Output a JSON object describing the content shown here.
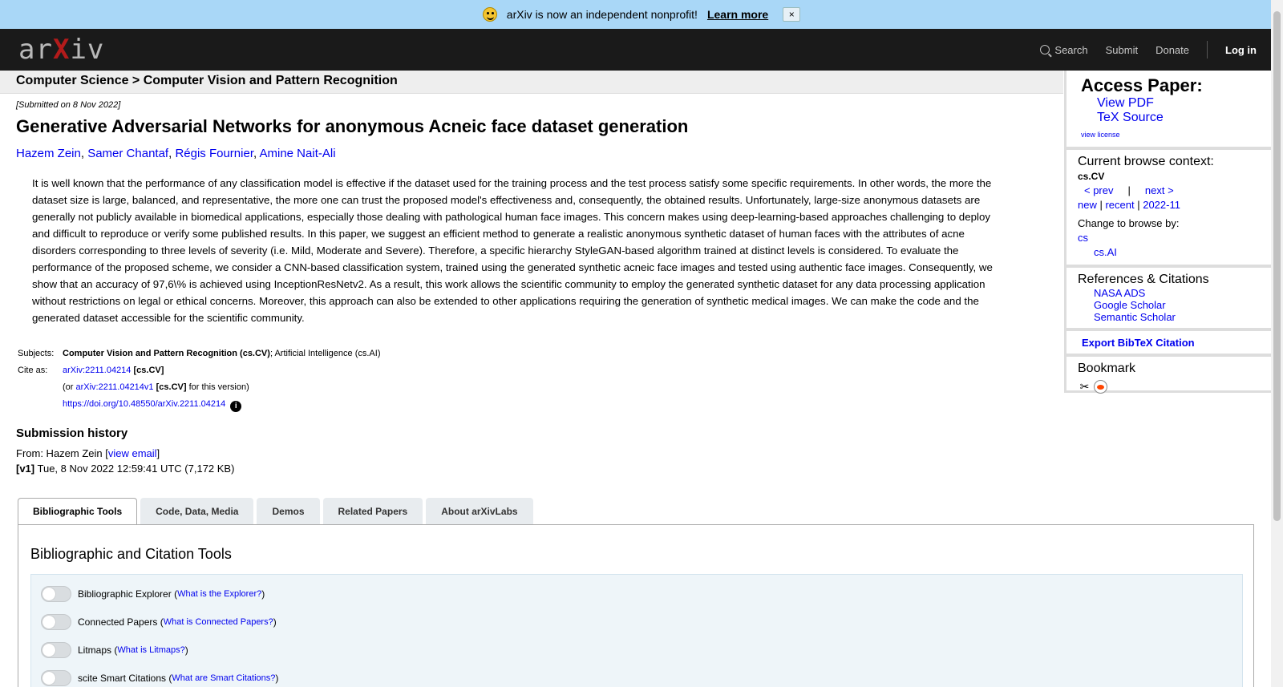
{
  "banner": {
    "text": "arXiv is now an independent nonprofit!",
    "link": "Learn more",
    "close": "×"
  },
  "header": {
    "logo_left": "ar",
    "logo_x": "X",
    "logo_right": "iv",
    "nav": {
      "search": "Search",
      "submit": "Submit",
      "donate": "Donate",
      "login": "Log in"
    }
  },
  "breadcrumb": "Computer Science > Computer Vision and Pattern Recognition",
  "dateline": "[Submitted on 8 Nov 2022]",
  "title": "Generative Adversarial Networks for anonymous Acneic face dataset generation",
  "authors": [
    "Hazem Zein",
    "Samer Chantaf",
    "Régis Fournier",
    "Amine Nait-Ali"
  ],
  "abstract": "It is well known that the performance of any classification model is effective if the dataset used for the training process and the test process satisfy some specific requirements. In other words, the more the dataset size is large, balanced, and representative, the more one can trust the proposed model's effectiveness and, consequently, the obtained results. Unfortunately, large-size anonymous datasets are generally not publicly available in biomedical applications, especially those dealing with pathological human face images. This concern makes using deep-learning-based approaches challenging to deploy and difficult to reproduce or verify some published results. In this paper, we suggest an efficient method to generate a realistic anonymous synthetic dataset of human faces with the attributes of acne disorders corresponding to three levels of severity (i.e. Mild, Moderate and Severe). Therefore, a specific hierarchy StyleGAN-based algorithm trained at distinct levels is considered. To evaluate the performance of the proposed scheme, we consider a CNN-based classification system, trained using the generated synthetic acneic face images and tested using authentic face images. Consequently, we show that an accuracy of 97,6\\% is achieved using InceptionResNetv2. As a result, this work allows the scientific community to employ the generated synthetic dataset for any data processing application without restrictions on legal or ethical concerns. Moreover, this approach can also be extended to other applications requiring the generation of synthetic medical images. We can make the code and the generated dataset accessible for the scientific community.",
  "meta": {
    "subjects_label": "Subjects:",
    "subjects_primary": "Computer Vision and Pattern Recognition (cs.CV)",
    "subjects_rest": "; Artificial Intelligence (cs.AI)",
    "cite_label": "Cite as:",
    "cite_id": "arXiv:2211.04214",
    "cite_cat": "[cs.CV]",
    "or_prefix": "(or ",
    "cite_version": "arXiv:2211.04214v1",
    "cite_version_cat": "[cs.CV]",
    "or_suffix": " for this version)",
    "doi": "https://doi.org/10.48550/arXiv.2211.04214",
    "info": "i"
  },
  "history": {
    "heading": "Submission history",
    "from_prefix": "From: Hazem Zein [",
    "view_email": "view email",
    "from_suffix": "]",
    "v1_label": "[v1]",
    "v1_text": " Tue, 8 Nov 2022 12:59:41 UTC (7,172 KB)"
  },
  "tabs": [
    "Bibliographic Tools",
    "Code, Data, Media",
    "Demos",
    "Related Papers",
    "About arXivLabs"
  ],
  "panel": {
    "heading": "Bibliographic and Citation Tools",
    "tools": [
      {
        "name": "Bibliographic Explorer",
        "q": "What is the Explorer?"
      },
      {
        "name": "Connected Papers",
        "q": "What is Connected Papers?"
      },
      {
        "name": "Litmaps",
        "q": "What is Litmaps?"
      },
      {
        "name": "scite Smart Citations",
        "q": "What are Smart Citations?"
      }
    ]
  },
  "sidebar": {
    "access": {
      "heading": "Access Paper:",
      "pdf": "View PDF",
      "tex": "TeX Source",
      "license": "view license"
    },
    "context": {
      "heading": "Current browse context:",
      "current": "cs.CV",
      "prev": "< prev",
      "bar": "|",
      "next": "next >",
      "new": "new",
      "recent": "recent",
      "month": "2022-11",
      "change": "Change to browse by:",
      "cs": "cs",
      "csai": "cs.AI"
    },
    "refs": {
      "heading": "References & Citations",
      "items": [
        "NASA ADS",
        "Google Scholar",
        "Semantic Scholar"
      ]
    },
    "export": "Export BibTeX Citation",
    "bookmark": "Bookmark"
  }
}
